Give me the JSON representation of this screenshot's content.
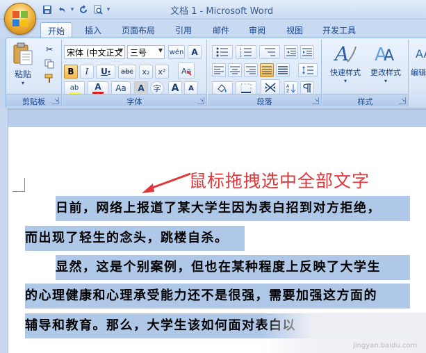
{
  "window": {
    "title": "文档 1 - Microsoft Word"
  },
  "qat": {
    "customize_glyph": "▾"
  },
  "tabs": [
    "开始",
    "插入",
    "页面布局",
    "引用",
    "邮件",
    "审阅",
    "视图",
    "开发工具"
  ],
  "ribbon": {
    "clipboard": {
      "label": "剪贴板",
      "paste_label": "粘贴"
    },
    "font": {
      "label": "字体",
      "font_name": "宋体 (中文正文",
      "font_size": "三号",
      "bold": "B",
      "italic": "I",
      "underline": "U",
      "strike": "abc",
      "subscript": "x₂",
      "superscript": "x²",
      "case": "Aa",
      "char_border": "A",
      "phonetic": "wén",
      "enclose": "字",
      "grow": "A",
      "shrink": "A",
      "highlight": "ab",
      "font_color": "A"
    },
    "paragraph": {
      "label": "段落"
    },
    "styles": {
      "label": "样式",
      "quick_styles": "快速样式",
      "change_styles": "更改样式"
    },
    "editing": {
      "label": "编辑"
    }
  },
  "document": {
    "annotation": "鼠标拖拽选中全部文字",
    "lines": [
      "日前，网络上报道了某大学生因为表白招到对方拒绝，",
      "而出现了轻生的念头，跳楼自杀。",
      "显然，这是个别案例，但也在某种程度上反映了大学生",
      "的心理健康和心理承受能力还不是很强，需要加强这方面的",
      "辅导和教育。那么，大学生该如何面对表白以"
    ],
    "watermark": "jingyan.baidu.com"
  },
  "colors": {
    "selection": "#b0c8e8",
    "annotation": "#e0373a",
    "font_color_bar": "#e02020",
    "highlight_bar": "#ffff00"
  }
}
